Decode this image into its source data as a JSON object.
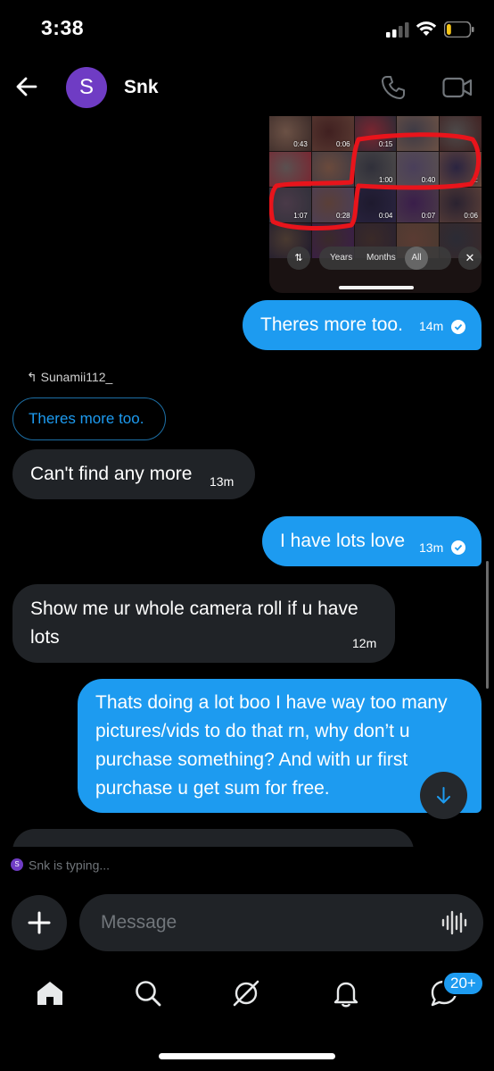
{
  "status_bar": {
    "time": "3:38",
    "battery_level": 0.2,
    "battery_color": "#f5c518"
  },
  "header": {
    "back_icon": "arrow-left-icon",
    "avatar_letter": "S",
    "avatar_color": "#6f3cc4",
    "contact_name": "Snk",
    "call_icon": "phone-icon",
    "video_icon": "video-camera-icon"
  },
  "media_preview": {
    "durations": [
      "0:43",
      "0:06",
      "0:15",
      "",
      "",
      "",
      "",
      "1:00",
      "0:40",
      "1:",
      "1:07",
      "0:28",
      "0:04",
      "0:07",
      "0:06",
      "",
      "",
      "",
      "",
      ""
    ],
    "sort_icon": "sort-arrows-icon",
    "segment": [
      "Years",
      "Months",
      "All"
    ],
    "selected_segment": "All",
    "close_icon": "close-icon",
    "faint_labels": [
      "6",
      "0:08"
    ],
    "circle_color": "#e8141b"
  },
  "messages": [
    {
      "direction": "out",
      "text": "Theres more too.",
      "time": "14m",
      "status_icon": "check-circle-icon"
    },
    {
      "direction": "reply_ref",
      "reply_icon": "reply-arrow-icon",
      "reply_to": "Sunamii112_",
      "quoted": "Theres more too."
    },
    {
      "direction": "in",
      "text": "Can't find any more",
      "time": "13m"
    },
    {
      "direction": "out",
      "text": "I have lots love",
      "time": "13m",
      "status_icon": "check-circle-icon"
    },
    {
      "direction": "in",
      "lines": [
        "Show me ur whole camera roll if u have",
        "lots"
      ],
      "time": "12m"
    },
    {
      "direction": "out",
      "lines": [
        "Thats doing a lot boo I have way too many",
        "pictures/vids to do that rn, why don’t u",
        "purchase something? And with ur first",
        "purchase u get sum for free."
      ]
    }
  ],
  "scroll_down_icon": "arrow-down-icon",
  "typing": {
    "avatar_letter": "S",
    "text": "Snk is typing..."
  },
  "composer": {
    "plus_icon": "plus-icon",
    "placeholder": "Message",
    "voice_icon": "voice-waveform-icon"
  },
  "tabbar": {
    "tabs": [
      "home-icon",
      "search-icon",
      "grok-icon",
      "bell-icon",
      "messages-icon"
    ],
    "messages_badge": "20+"
  },
  "colors": {
    "outgoing_bubble": "#1d9bf0",
    "incoming_bubble": "#202327",
    "background": "#000000"
  }
}
